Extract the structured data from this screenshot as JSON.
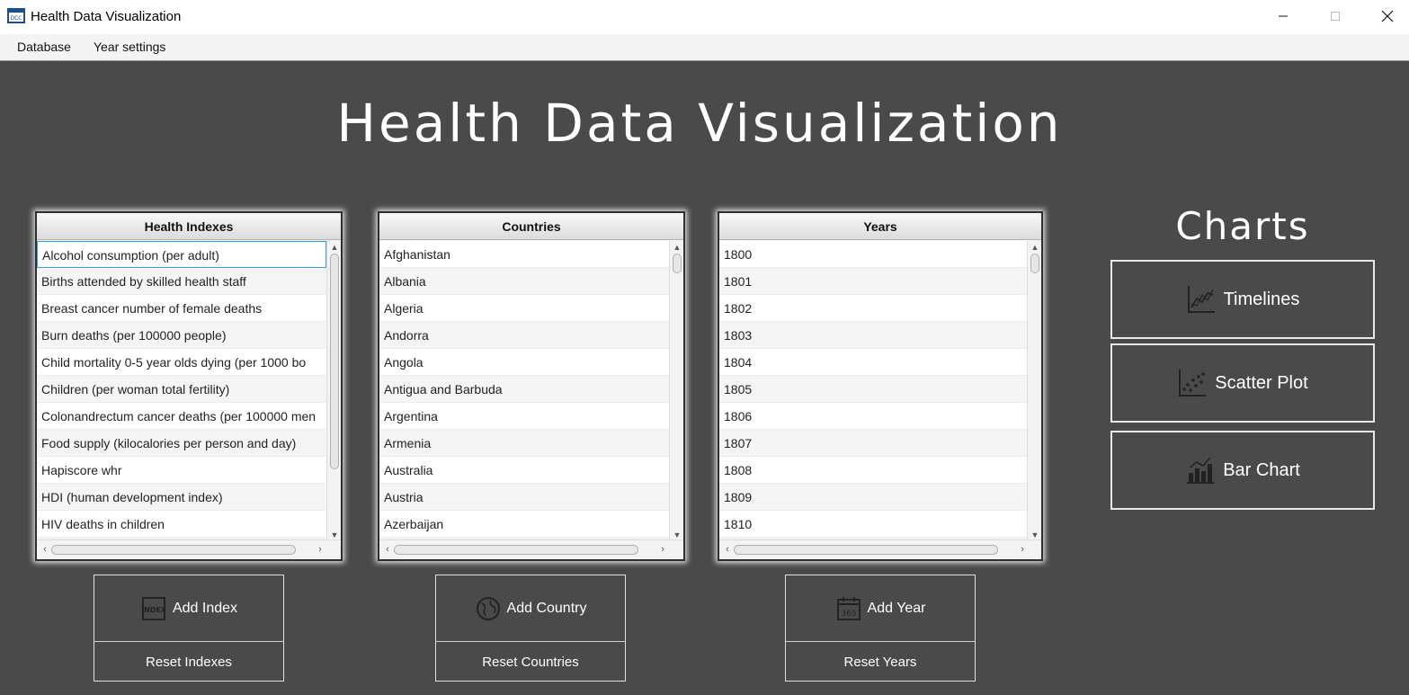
{
  "window": {
    "title": "Health Data Visualization"
  },
  "menu": {
    "database": "Database",
    "year_settings": "Year settings"
  },
  "main": {
    "title": "Health Data Visualization",
    "charts_title": "Charts"
  },
  "panels": {
    "indexes": {
      "header": "Health Indexes",
      "items": [
        "Alcohol consumption (per adult)",
        "Births attended by skilled health staff",
        "Breast cancer number of female deaths",
        "Burn deaths (per 100000 people)",
        "Child mortality 0-5 year olds dying (per 1000 bo",
        "Children (per woman total fertility)",
        "Colonandrectum cancer deaths (per 100000 men",
        "Food supply (kilocalories per person and day)",
        "Hapiscore whr",
        "HDI (human development index)",
        "HIV deaths in children"
      ]
    },
    "countries": {
      "header": "Countries",
      "items": [
        "Afghanistan",
        "Albania",
        "Algeria",
        "Andorra",
        "Angola",
        "Antigua and Barbuda",
        "Argentina",
        "Armenia",
        "Australia",
        "Austria",
        "Azerbaijan"
      ]
    },
    "years": {
      "header": "Years",
      "items": [
        "1800",
        "1801",
        "1802",
        "1803",
        "1804",
        "1805",
        "1806",
        "1807",
        "1808",
        "1809",
        "1810"
      ]
    }
  },
  "buttons": {
    "add_index": "Add Index",
    "reset_indexes": "Reset Indexes",
    "add_country": "Add Country",
    "reset_countries": "Reset Countries",
    "add_year": "Add Year",
    "reset_years": "Reset Years"
  },
  "charts": {
    "timelines": "Timelines",
    "scatter_plot": "Scatter Plot",
    "bar_chart": "Bar Chart"
  },
  "icons": {
    "index": "index-icon",
    "globe": "globe-icon",
    "calendar": "calendar-365-icon",
    "timeline": "line-chart-icon",
    "scatter": "scatter-plot-icon",
    "bar": "bar-chart-icon"
  },
  "colors": {
    "background": "#4a4a4a",
    "selection": "#3aa0d8"
  }
}
